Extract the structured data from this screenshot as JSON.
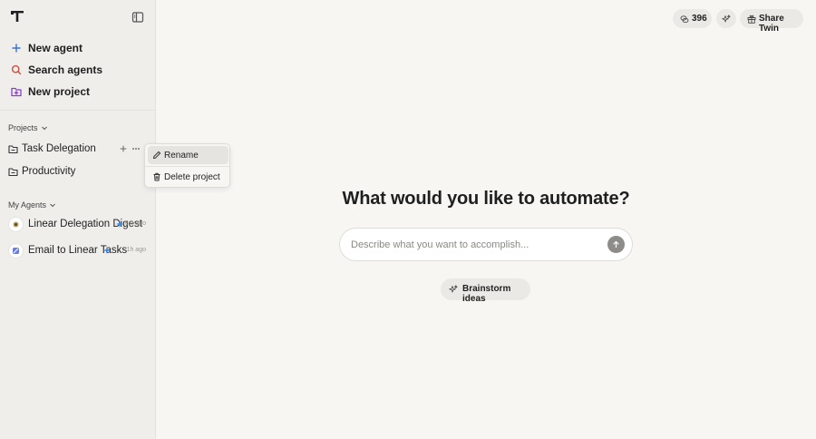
{
  "sidebar": {
    "nav": [
      {
        "label": "New agent",
        "icon": "plus-icon",
        "color": "#3b6fd8"
      },
      {
        "label": "Search agents",
        "icon": "search-icon",
        "color": "#d94a3a"
      },
      {
        "label": "New project",
        "icon": "folder-plus-icon",
        "color": "#8a3fc8"
      }
    ],
    "projects_header": "Projects",
    "projects": [
      {
        "label": "Task Delegation"
      },
      {
        "label": "Productivity"
      }
    ],
    "agents_header": "My Agents",
    "agents": [
      {
        "label": "Linear Delegation Digest",
        "time": "6m ago"
      },
      {
        "label": "Email to Linear Tasks",
        "time": "1h ago"
      }
    ]
  },
  "context_menu": {
    "items": [
      {
        "label": "Rename",
        "icon": "pencil-icon"
      },
      {
        "label": "Delete project",
        "icon": "trash-icon"
      }
    ]
  },
  "topbar": {
    "credits": "396",
    "share_label": "Share Twin"
  },
  "main": {
    "headline": "What would you like to automate?",
    "prompt_placeholder": "Describe what you want to accomplish...",
    "brainstorm_label": "Brainstorm ideas"
  },
  "colors": {
    "accent_blue": "#3b6fd8",
    "spark_blue": "#3d8bf0"
  }
}
